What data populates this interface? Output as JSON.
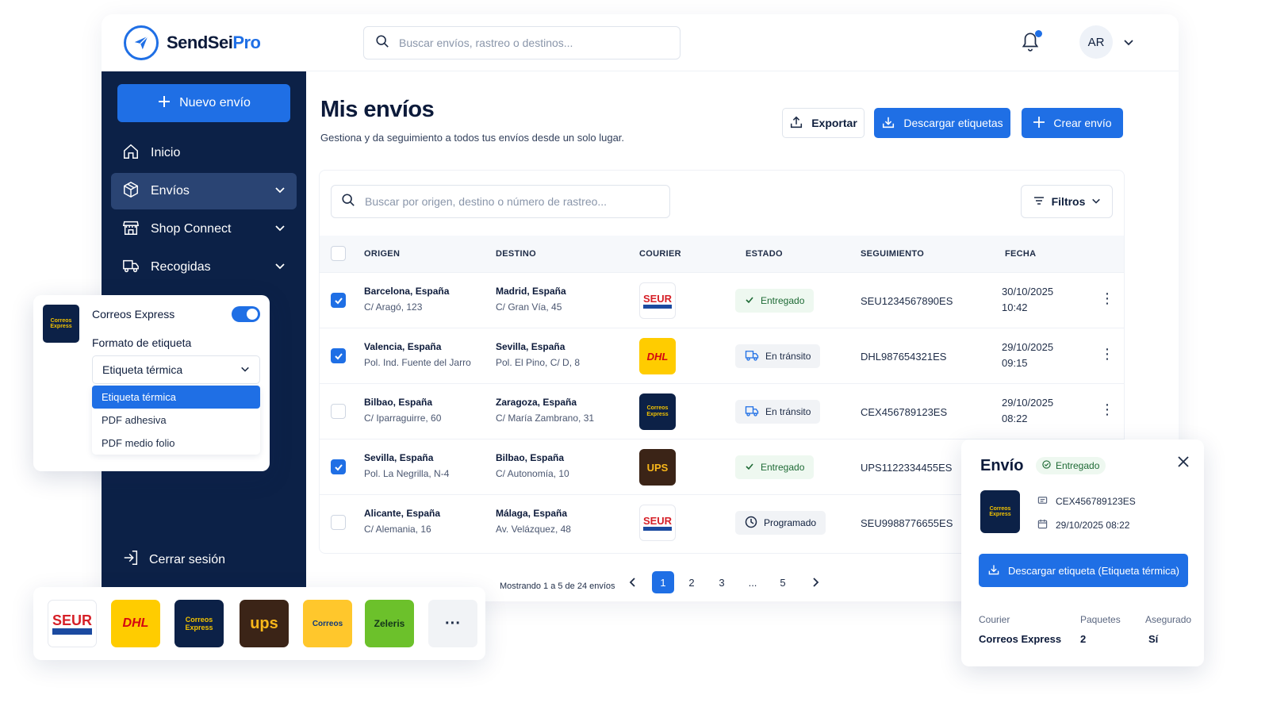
{
  "app": {
    "brand": "SendSei",
    "brand_suffix": "Pro"
  },
  "topbar": {
    "search_placeholder": "Buscar envíos, rastreo o destinos...",
    "avatar_initials": "AR"
  },
  "sidebar": {
    "new_button": "Nuevo envío",
    "items": [
      {
        "label": "Inicio"
      },
      {
        "label": "Envíos"
      },
      {
        "label": "Shop Connect"
      },
      {
        "label": "Recogidas"
      }
    ],
    "logout": "Cerrar sesión"
  },
  "page": {
    "title": "Mis envíos",
    "subtitle": "Gestiona y da seguimiento a todos tus envíos desde un solo lugar.",
    "export_label": "Exportar",
    "download_labels": "Descargar etiquetas",
    "create_label": "Crear envío"
  },
  "table": {
    "search_placeholder": "Buscar por origen, destino o número de rastreo...",
    "filters_label": "Filtros",
    "headers": {
      "origin": "ORIGEN",
      "destination": "DESTINO",
      "courier": "COURIER",
      "status": "ESTADO",
      "tracking": "SEGUIMIENTO",
      "date": "FECHA"
    },
    "rows": [
      {
        "checked": true,
        "origin": "Barcelona, España",
        "origin_addr": "C/ Aragó, 123",
        "dest": "Madrid, España",
        "dest_addr": "C/ Gran Vía, 45",
        "courier": "SEUR",
        "status": "Entregado",
        "tracking": "SEU1234567890ES",
        "date": "30/10/2025",
        "time": "10:42"
      },
      {
        "checked": true,
        "origin": "Valencia, España",
        "origin_addr": "Pol. Ind. Fuente del Jarro",
        "dest": "Sevilla, España",
        "dest_addr": "Pol. El Pino, C/ D, 8",
        "courier": "DHL",
        "status": "En tránsito",
        "tracking": "DHL987654321ES",
        "date": "29/10/2025",
        "time": "09:15"
      },
      {
        "checked": false,
        "origin": "Bilbao, España",
        "origin_addr": "C/ Iparraguirre, 60",
        "dest": "Zaragoza, España",
        "dest_addr": "C/ María Zambrano, 31",
        "courier": "Correos Express",
        "status": "En tránsito",
        "tracking": "CEX456789123ES",
        "date": "29/10/2025",
        "time": "08:22"
      },
      {
        "checked": true,
        "origin": "Sevilla, España",
        "origin_addr": "Pol. La Negrilla, N-4",
        "dest": "Bilbao, España",
        "dest_addr": "C/ Autonomía, 10",
        "courier": "UPS",
        "status": "Entregado",
        "tracking": "UPS1122334455ES",
        "date": "",
        "time": ""
      },
      {
        "checked": false,
        "origin": "Alicante, España",
        "origin_addr": "C/ Alemania, 16",
        "dest": "Málaga, España",
        "dest_addr": "Av. Velázquez, 48",
        "courier": "SEUR",
        "status": "Programado",
        "tracking": "SEU9988776655ES",
        "date": "",
        "time": ""
      }
    ]
  },
  "pagination": {
    "info": "Mostrando 1 a 5 de 24 envíos",
    "pages": [
      "1",
      "2",
      "3",
      "...",
      "5"
    ],
    "current": "1"
  },
  "label_popup": {
    "courier": "Correos Express",
    "enabled": true,
    "format_label": "Formato de etiqueta",
    "selected": "Etiqueta térmica",
    "options": [
      "Etiqueta térmica",
      "PDF adhesiva",
      "PDF medio folio"
    ]
  },
  "courier_strip": {
    "items": [
      {
        "name": "SEUR",
        "text": "SEUR"
      },
      {
        "name": "DHL",
        "text": "DHL"
      },
      {
        "name": "Correos Express",
        "text": "Correos Express"
      },
      {
        "name": "UPS",
        "text": "ups"
      },
      {
        "name": "Correos",
        "text": "Correos"
      },
      {
        "name": "Zeleris",
        "text": "Zeleris"
      }
    ],
    "more": "···"
  },
  "detail": {
    "title": "Envío",
    "status": "Entregado",
    "tracking": "CEX456789123ES",
    "datetime": "29/10/2025 08:22",
    "button": "Descargar etiqueta (Etiqueta térmica)",
    "courier_label": "Courier",
    "courier_value": "Correos Express",
    "packages_label": "Paquetes",
    "packages_value": "2",
    "insured_label": "Asegurado",
    "insured_value": "Sí"
  },
  "colors": {
    "accent": "#1f6fe5",
    "sidebar": "#0c2147",
    "success": "#1e6a35"
  },
  "icons": [
    "search-icon",
    "bell-icon",
    "plus-icon",
    "home-icon",
    "box-icon",
    "store-icon",
    "truck-icon",
    "logout-icon",
    "upload-icon",
    "download-icon",
    "filter-icon",
    "check-icon",
    "clock-icon",
    "close-icon",
    "calendar-icon",
    "tag-icon"
  ]
}
